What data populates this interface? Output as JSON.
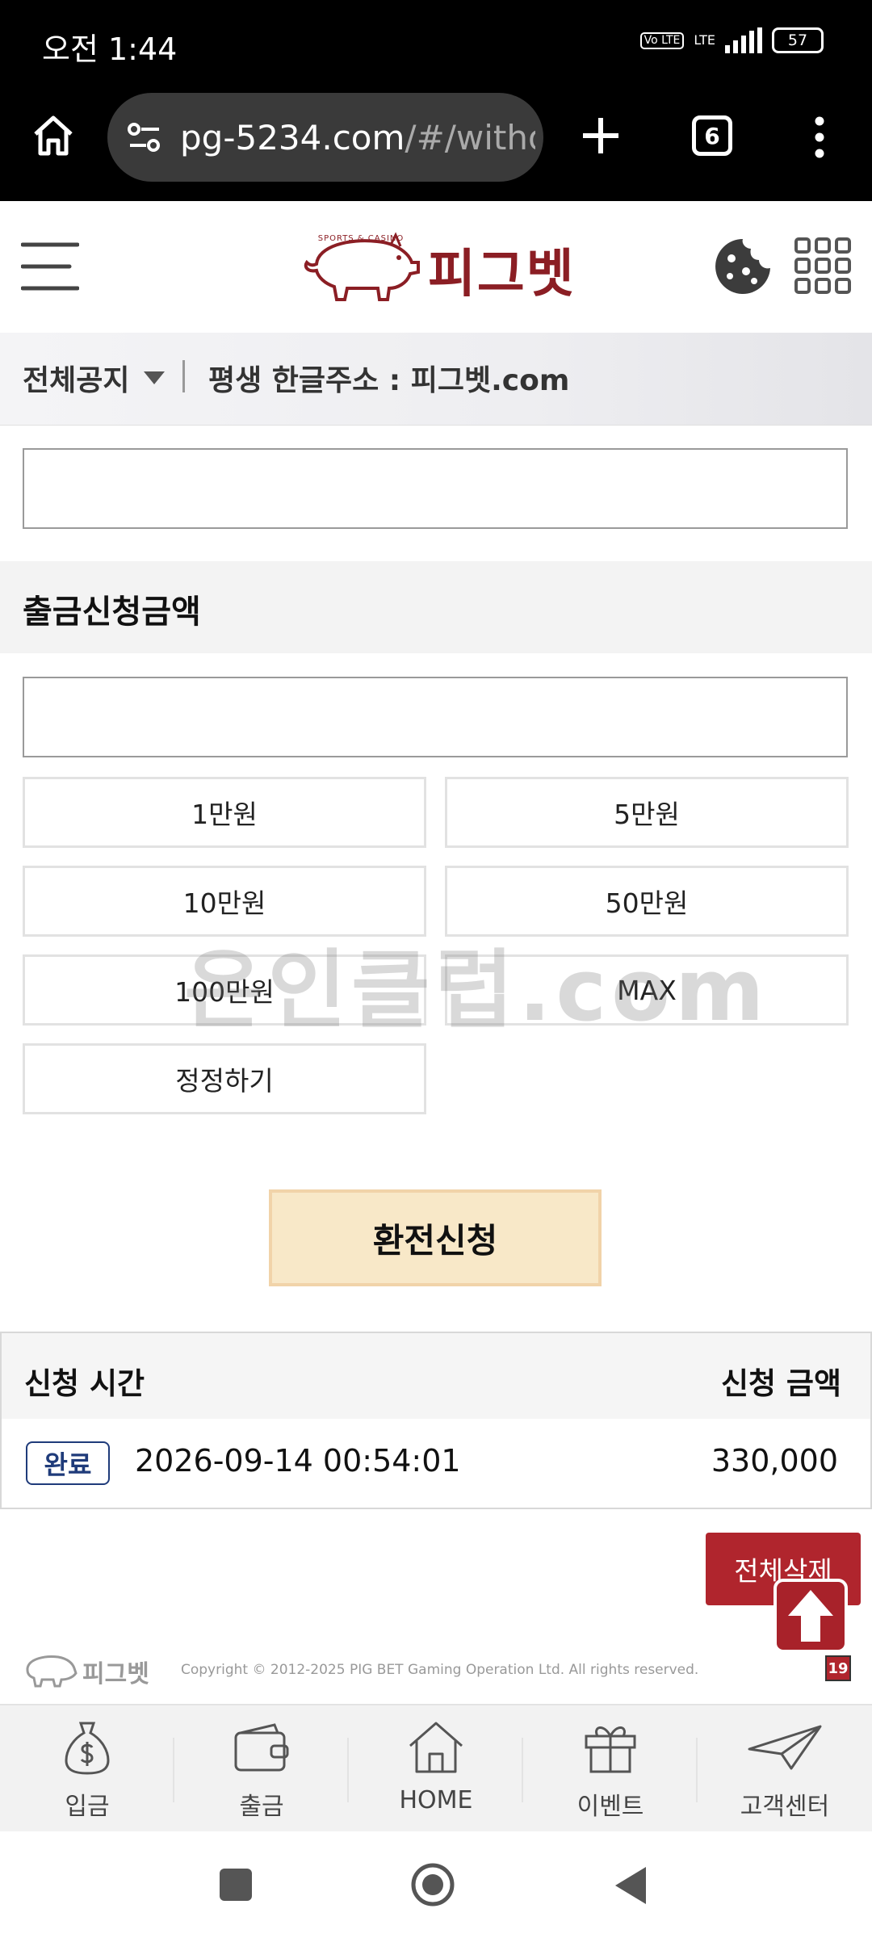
{
  "status_bar": {
    "time": "오전 1:44",
    "volte": "Vo LTE",
    "network": "LTE",
    "battery": "57"
  },
  "browser": {
    "url_main": "pg-5234.com",
    "url_dim": "/#/withd",
    "tab_count": "6"
  },
  "header": {
    "logo_text": "피그벳",
    "logo_small": "SPORTS & CASINO"
  },
  "notice": {
    "category": "전체공지",
    "message": "평생 한글주소 : 피그벳.com"
  },
  "form": {
    "section_title": "출금신청금액",
    "amount_buttons": [
      "1만원",
      "5만원",
      "10만원",
      "50만원",
      "100만원",
      "MAX"
    ],
    "reset_label": "정정하기",
    "submit_label": "환전신청"
  },
  "history": {
    "col_time": "신청 시간",
    "col_amount": "신청 금액",
    "rows": [
      {
        "status": "완료",
        "time": "2026-09-14 00:54:01",
        "amount": "330,000"
      }
    ],
    "delete_all_label": "전체삭제"
  },
  "footer": {
    "logo_text": "피그벳",
    "copyright": "Copyright © 2012-2025 PIG BET Gaming Operation Ltd. All rights reserved.",
    "age_badge": "19"
  },
  "watermark": "온인클럽.com",
  "tabbar": {
    "items": [
      "입금",
      "출금",
      "HOME",
      "이벤트",
      "고객센터"
    ]
  },
  "colors": {
    "brand_red": "#8b1e24",
    "button_red": "#b0252d",
    "submit_bg": "#f8e8c8",
    "badge_blue": "#1f3b7a"
  }
}
